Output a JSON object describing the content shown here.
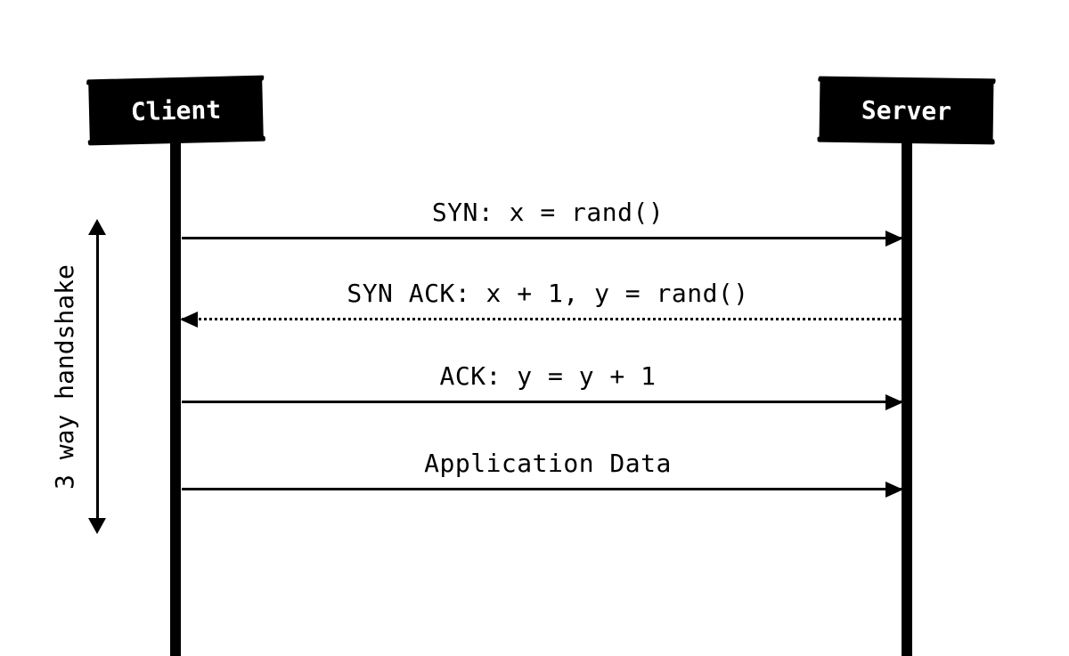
{
  "participants": {
    "client": "Client",
    "server": "Server"
  },
  "messages": {
    "m1": "SYN: x = rand()",
    "m2": "SYN ACK: x + 1, y = rand()",
    "m3": "ACK: y = y + 1",
    "m4": "Application Data"
  },
  "annotation": {
    "bracket": "3 way handshake"
  }
}
